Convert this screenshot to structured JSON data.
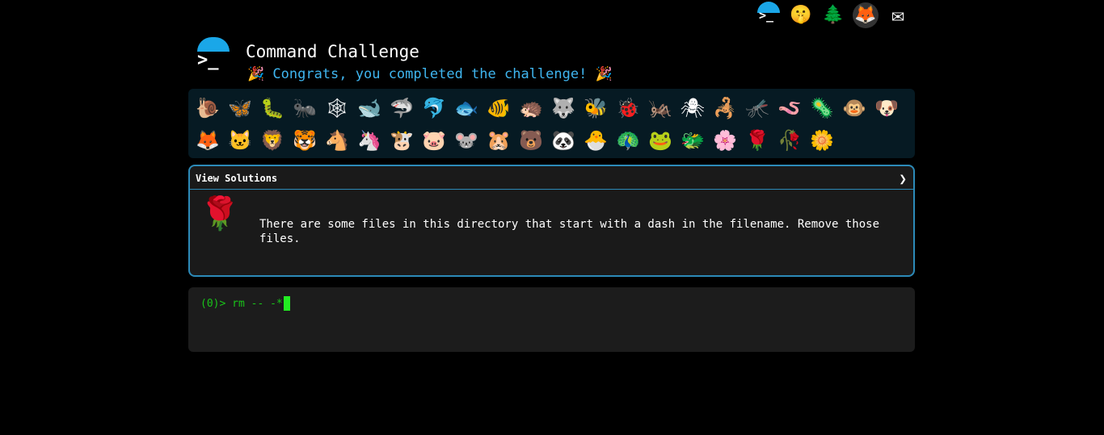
{
  "topnav": {
    "items": [
      {
        "name": "commandchallenge-icon",
        "glyph": ">_"
      },
      {
        "name": "shushing-face-icon",
        "glyph": "🤫"
      },
      {
        "name": "tree-icon",
        "glyph": "🌲"
      },
      {
        "name": "gitlab-icon",
        "glyph": "🦊"
      },
      {
        "name": "envelope-icon",
        "glyph": "✉"
      }
    ]
  },
  "header": {
    "title": "Command Challenge",
    "subtitle": "🎉 Congrats, you completed the challenge! 🎉",
    "logo_glyph": ">_"
  },
  "emoji_rows": [
    [
      "🐌",
      "🦋",
      "🐛",
      "🐜",
      "🕸",
      "🐋",
      "🦈",
      "🐬",
      "🐟",
      "🐠",
      "🦔",
      "🐺",
      "🐝",
      "🐞",
      "🦗",
      "🕷",
      "🦂",
      "🦟",
      "🪱",
      "🦠",
      "🐵",
      "🐶"
    ],
    [
      "🦊",
      "🐱",
      "🦁",
      "🐯",
      "🐴",
      "🦄",
      "🐮",
      "🐷",
      "🐭",
      "🐹",
      "🐻",
      "🐼",
      "🐣",
      "🦚",
      "🐸",
      "🐲",
      "🌸",
      "🌹",
      "🥀",
      "🌼"
    ]
  ],
  "solutions": {
    "label": "View Solutions",
    "chevron": "❯",
    "icon": "🌹",
    "description": "There are some files in this directory that start with a dash in the filename. Remove those files."
  },
  "terminal": {
    "prompt": "(0)> ",
    "command": "rm -- -*"
  }
}
